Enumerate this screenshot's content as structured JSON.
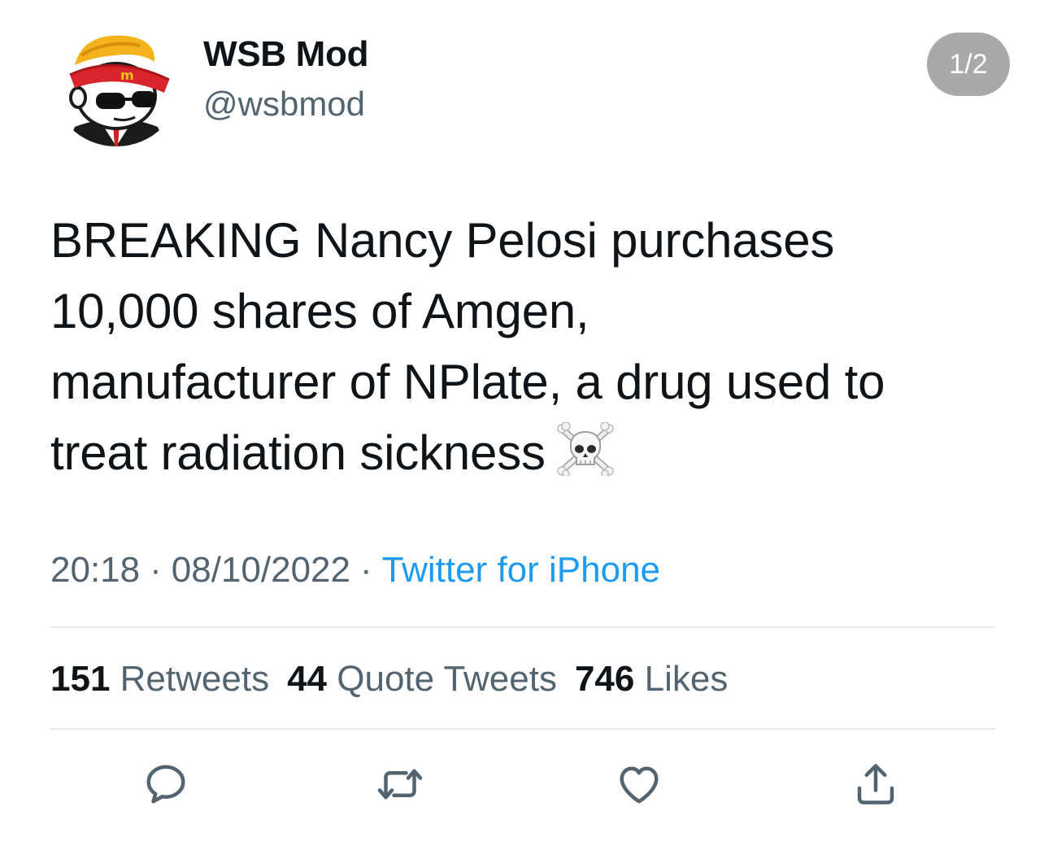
{
  "tweet": {
    "display_name": "WSB Mod",
    "handle": "@wsbmod",
    "page_indicator": "1/2",
    "text_lines": [
      "BREAKING Nancy Pelosi purchases",
      "10,000 shares of Amgen,",
      "manufacturer of NPlate, a drug used to",
      "treat radiation sickness"
    ],
    "emoji": "skull-and-crossbones",
    "time": "20:18",
    "date": "08/10/2022",
    "separator": "·",
    "source": "Twitter for iPhone",
    "stats": {
      "retweets_count": "151",
      "retweets_label": "Retweets",
      "quotes_count": "44",
      "quotes_label": "Quote Tweets",
      "likes_count": "746",
      "likes_label": "Likes"
    },
    "actions": [
      "reply-icon",
      "retweet-icon",
      "like-icon",
      "share-icon"
    ]
  },
  "colors": {
    "text_primary": "#0f1419",
    "text_secondary": "#536471",
    "link": "#1d9bf0",
    "divider": "#e7e9ea",
    "pill": "#a9a9a9"
  }
}
